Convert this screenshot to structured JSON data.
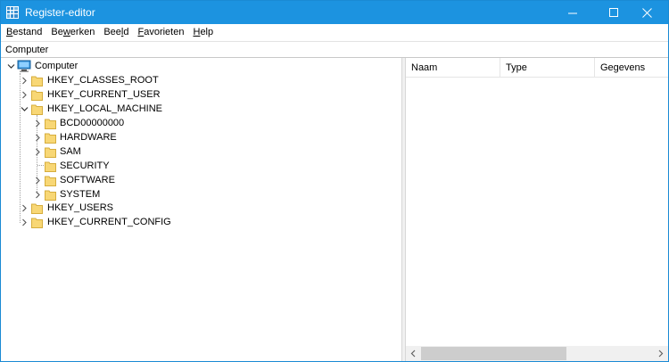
{
  "window": {
    "title": "Register-editor",
    "accent_color": "#1c93e0"
  },
  "menu": {
    "items": [
      {
        "label_pre": "",
        "accel": "B",
        "label_post": "estand"
      },
      {
        "label_pre": "Be",
        "accel": "w",
        "label_post": "erken"
      },
      {
        "label_pre": "Bee",
        "accel": "l",
        "label_post": "d"
      },
      {
        "label_pre": "",
        "accel": "F",
        "label_post": "avorieten"
      },
      {
        "label_pre": "",
        "accel": "H",
        "label_post": "elp"
      }
    ]
  },
  "address": {
    "value": "Computer"
  },
  "tree": {
    "root": {
      "label": "Computer",
      "icon": "computer-icon",
      "expanded": true
    },
    "hives": [
      {
        "label": "HKEY_CLASSES_ROOT",
        "expanded": false
      },
      {
        "label": "HKEY_CURRENT_USER",
        "expanded": false
      },
      {
        "label": "HKEY_LOCAL_MACHINE",
        "expanded": true
      },
      {
        "label": "HKEY_USERS",
        "expanded": false
      },
      {
        "label": "HKEY_CURRENT_CONFIG",
        "expanded": false
      }
    ],
    "local_machine_children": [
      {
        "label": "BCD00000000",
        "has_children": true
      },
      {
        "label": "HARDWARE",
        "has_children": true
      },
      {
        "label": "SAM",
        "has_children": true
      },
      {
        "label": "SECURITY",
        "has_children": false
      },
      {
        "label": "SOFTWARE",
        "has_children": true
      },
      {
        "label": "SYSTEM",
        "has_children": true
      }
    ]
  },
  "list": {
    "columns": [
      "Naam",
      "Type",
      "Gegevens"
    ]
  }
}
